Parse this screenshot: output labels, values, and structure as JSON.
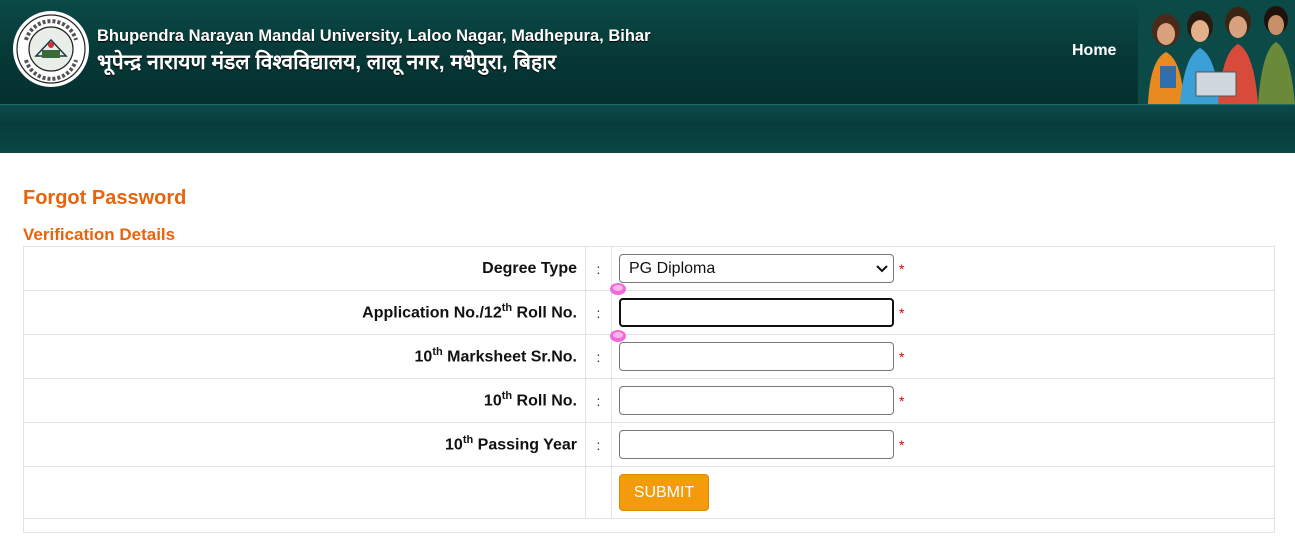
{
  "header": {
    "title_en": "Bhupendra Narayan Mandal University, Laloo Nagar, Madhepura, Bihar",
    "title_hi": "भूपेन्द्र नारायण मंडल विश्वविद्यालय, लालू नगर, मधेपुरा, बिहार",
    "nav_home": "Home"
  },
  "page": {
    "title": "Forgot Password",
    "section": "Verification Details"
  },
  "form": {
    "degree_type": {
      "label": "Degree Type",
      "colon": ":",
      "value": "PG Diploma",
      "required": "*"
    },
    "application_no": {
      "label_pre": "Application No./12",
      "label_sup": "th",
      "label_post": " Roll No.",
      "colon": ":",
      "value": "",
      "required": "*"
    },
    "marksheet_sr": {
      "label_pre": "10",
      "label_sup": "th",
      "label_post": " Marksheet Sr.No.",
      "colon": ":",
      "value": "",
      "required": "*"
    },
    "roll_no": {
      "label_pre": "10",
      "label_sup": "th",
      "label_post": " Roll No.",
      "colon": ":",
      "value": "",
      "required": "*"
    },
    "passing_year": {
      "label_pre": "10",
      "label_sup": "th",
      "label_post": " Passing Year",
      "colon": ":",
      "value": "",
      "required": "*"
    },
    "submit_label": "SUBMIT"
  },
  "colors": {
    "header_bg": "#063836",
    "accent_orange": "#e8640c",
    "button_bg": "#f39b0b",
    "required_red": "#e00000"
  },
  "icons": {
    "logo": "university-seal-icon",
    "banner": "students-photo",
    "select_arrow": "chevron-down-icon",
    "selection_handles": "selection-handle-icon"
  }
}
